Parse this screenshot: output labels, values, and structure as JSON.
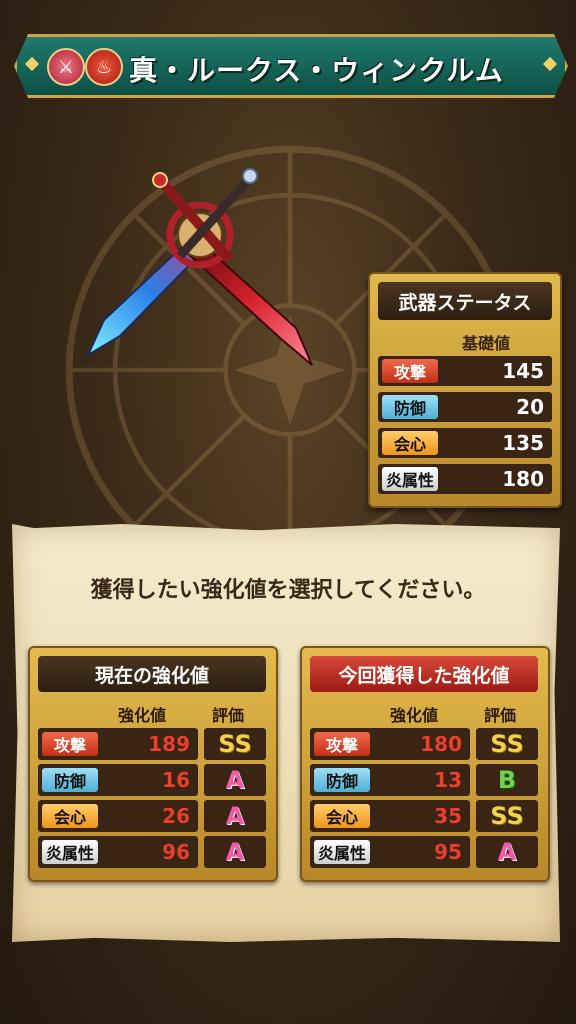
{
  "title": {
    "text": "真・ルークス・ウィンクルム",
    "icons": [
      "sword-icon",
      "fire-icon"
    ]
  },
  "weapon_status": {
    "title": "武器ステータス",
    "column_header": "基礎値",
    "rows": [
      {
        "label": "攻撃",
        "value": "145",
        "color": "red"
      },
      {
        "label": "防御",
        "value": "20",
        "color": "blue"
      },
      {
        "label": "会心",
        "value": "135",
        "color": "orange"
      },
      {
        "label": "炎属性",
        "value": "180",
        "color": "white"
      }
    ]
  },
  "prompt": "獲得したい強化値を選択してください。",
  "current": {
    "title": "現在の強化値",
    "header_value": "強化値",
    "header_grade": "評価",
    "rows": [
      {
        "label": "攻撃",
        "value": "189",
        "grade": "SS"
      },
      {
        "label": "防御",
        "value": "16",
        "grade": "A"
      },
      {
        "label": "会心",
        "value": "26",
        "grade": "A"
      },
      {
        "label": "炎属性",
        "value": "96",
        "grade": "A"
      }
    ]
  },
  "obtained": {
    "title": "今回獲得した強化値",
    "header_value": "強化値",
    "header_grade": "評価",
    "rows": [
      {
        "label": "攻撃",
        "value": "180",
        "grade": "SS"
      },
      {
        "label": "防御",
        "value": "13",
        "grade": "B"
      },
      {
        "label": "会心",
        "value": "35",
        "grade": "SS"
      },
      {
        "label": "炎属性",
        "value": "95",
        "grade": "A"
      }
    ]
  },
  "colors": {
    "banner": "#1f7a6d",
    "gold": "#e0b94c",
    "value_red": "#e8402a",
    "grade_ss": "#f3d24a",
    "grade_a": "#f05aa8",
    "grade_b": "#6ed34a"
  }
}
